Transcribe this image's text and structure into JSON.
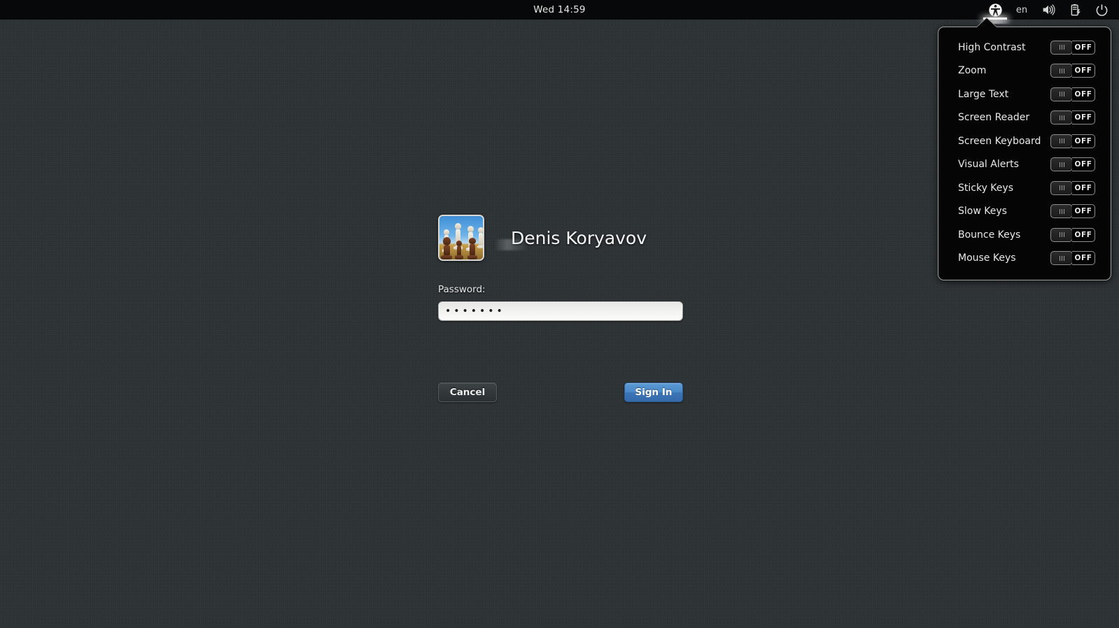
{
  "topbar": {
    "clock": "Wed 14:59",
    "tray": {
      "accessibility_icon": "accessibility-icon",
      "language": "en",
      "volume_icon": "volume-icon",
      "battery_icon": "battery-icon",
      "power_icon": "power-icon"
    }
  },
  "login": {
    "avatar_name": "user-avatar-chess",
    "username": "Denis Koryavov",
    "password_label": "Password:",
    "password_value": "•••••••",
    "password_placeholder": "",
    "cancel_label": "Cancel",
    "signin_label": "Sign In"
  },
  "a11y": {
    "items": [
      {
        "label": "High Contrast",
        "state": "OFF"
      },
      {
        "label": "Zoom",
        "state": "OFF"
      },
      {
        "label": "Large Text",
        "state": "OFF"
      },
      {
        "label": "Screen Reader",
        "state": "OFF"
      },
      {
        "label": "Screen Keyboard",
        "state": "OFF"
      },
      {
        "label": "Visual Alerts",
        "state": "OFF"
      },
      {
        "label": "Sticky Keys",
        "state": "OFF"
      },
      {
        "label": "Slow Keys",
        "state": "OFF"
      },
      {
        "label": "Bounce Keys",
        "state": "OFF"
      },
      {
        "label": "Mouse Keys",
        "state": "OFF"
      }
    ]
  },
  "colors": {
    "desktop": "#2e3336",
    "panel": "#070809",
    "popup": "#050505",
    "accent_blue": "#4a88c8",
    "text": "#e8eae8"
  }
}
